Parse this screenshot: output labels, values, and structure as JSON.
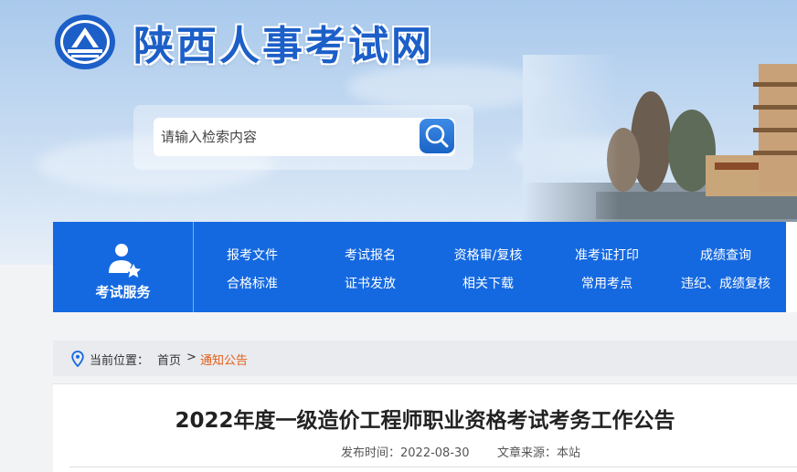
{
  "header": {
    "site_title": "陕西人事考试网",
    "search_placeholder": "请输入检索内容"
  },
  "nav": {
    "service_label": "考试服务",
    "links": [
      "报考文件",
      "考试报名",
      "资格审/复核",
      "准考证打印",
      "成绩查询",
      "合格标准",
      "证书发放",
      "相关下载",
      "常用考点",
      "违纪、成绩复核"
    ]
  },
  "breadcrumb": {
    "prefix": "当前位置：",
    "home": "首页",
    "separator": ">",
    "current": "通知公告"
  },
  "article": {
    "title": "2022年度一级造价工程师职业资格考试考务工作公告",
    "publish_time": "发布时间：2022-08-30",
    "source": "文章来源：本站"
  },
  "colors": {
    "brand_blue": "#1569e0",
    "title_blue": "#1c5fc8",
    "breadcrumb_current": "#e35d17"
  }
}
